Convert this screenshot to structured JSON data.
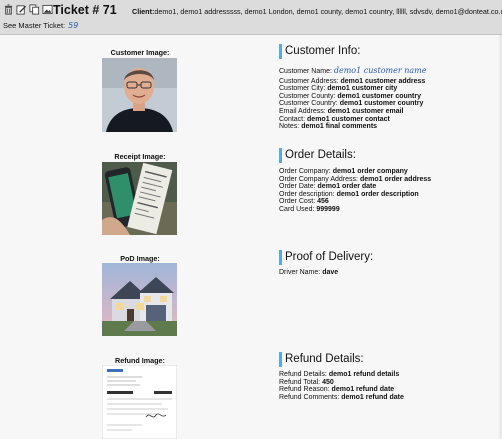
{
  "header": {
    "ticket_label": "Ticket # 71",
    "client_label": "Client:",
    "client_value": "demo1, demo1 addresssss, demo1 London, demo1 county, demo1 country, llllll, sdvsdv, demo1@donteat.co.uk,",
    "master_label": "See Master Ticket:",
    "master_value": "59",
    "icons": [
      "trash-icon",
      "edit-icon",
      "copy-icon",
      "image-icon"
    ]
  },
  "images": {
    "customer_caption": "Customer Image:",
    "receipt_caption": "Receipt Image:",
    "pod_caption": "PoD Image:",
    "refund_caption": "Refund Image:"
  },
  "customer": {
    "heading": "Customer Info:",
    "name_label": "Customer Name:",
    "name_value": "demo1 customer name",
    "address_label": "Customer Address:",
    "address_value": "demo1 customer address",
    "city_label": "Customer City:",
    "city_value": "demo1 customer city",
    "county_label": "Customer County:",
    "county_value": "demo1 customer country",
    "country_label": "Customer Country:",
    "country_value": "demo1 customer country",
    "email_label": "Email Address:",
    "email_value": "demo1 customer email",
    "contact_label": "Contact:",
    "contact_value": "demo1 customer contact",
    "notes_label": "Notes:",
    "notes_value": "demo1 final comments"
  },
  "order": {
    "heading": "Order Details:",
    "company_label": "Order Company:",
    "company_value": "demo1 order company",
    "company_address_label": "Order Company Address:",
    "company_address_value": "demo1 order address",
    "date_label": "Order Date:",
    "date_value": "demo1 order date",
    "description_label": "Order description:",
    "description_value": "demo1 order description",
    "cost_label": "Order Cost:",
    "cost_value": "456",
    "card_label": "Card Used:",
    "card_value": "999999"
  },
  "delivery": {
    "heading": "Proof of Delivery:",
    "driver_label": "Driver Name:",
    "driver_value": "dave"
  },
  "refund": {
    "heading": "Refund Details:",
    "details_label": "Refund Details:",
    "details_value": "demo1 refund details",
    "total_label": "Refund Total:",
    "total_value": "450",
    "reason_label": "Refund Reason:",
    "reason_value": "demo1 refund date",
    "comments_label": "Refund Comments:",
    "comments_value": "demo1 refund date"
  },
  "colors": {
    "header_bg": "#dcdcdc",
    "section_accent": "#5aa9d6",
    "link": "#2a5db0"
  }
}
